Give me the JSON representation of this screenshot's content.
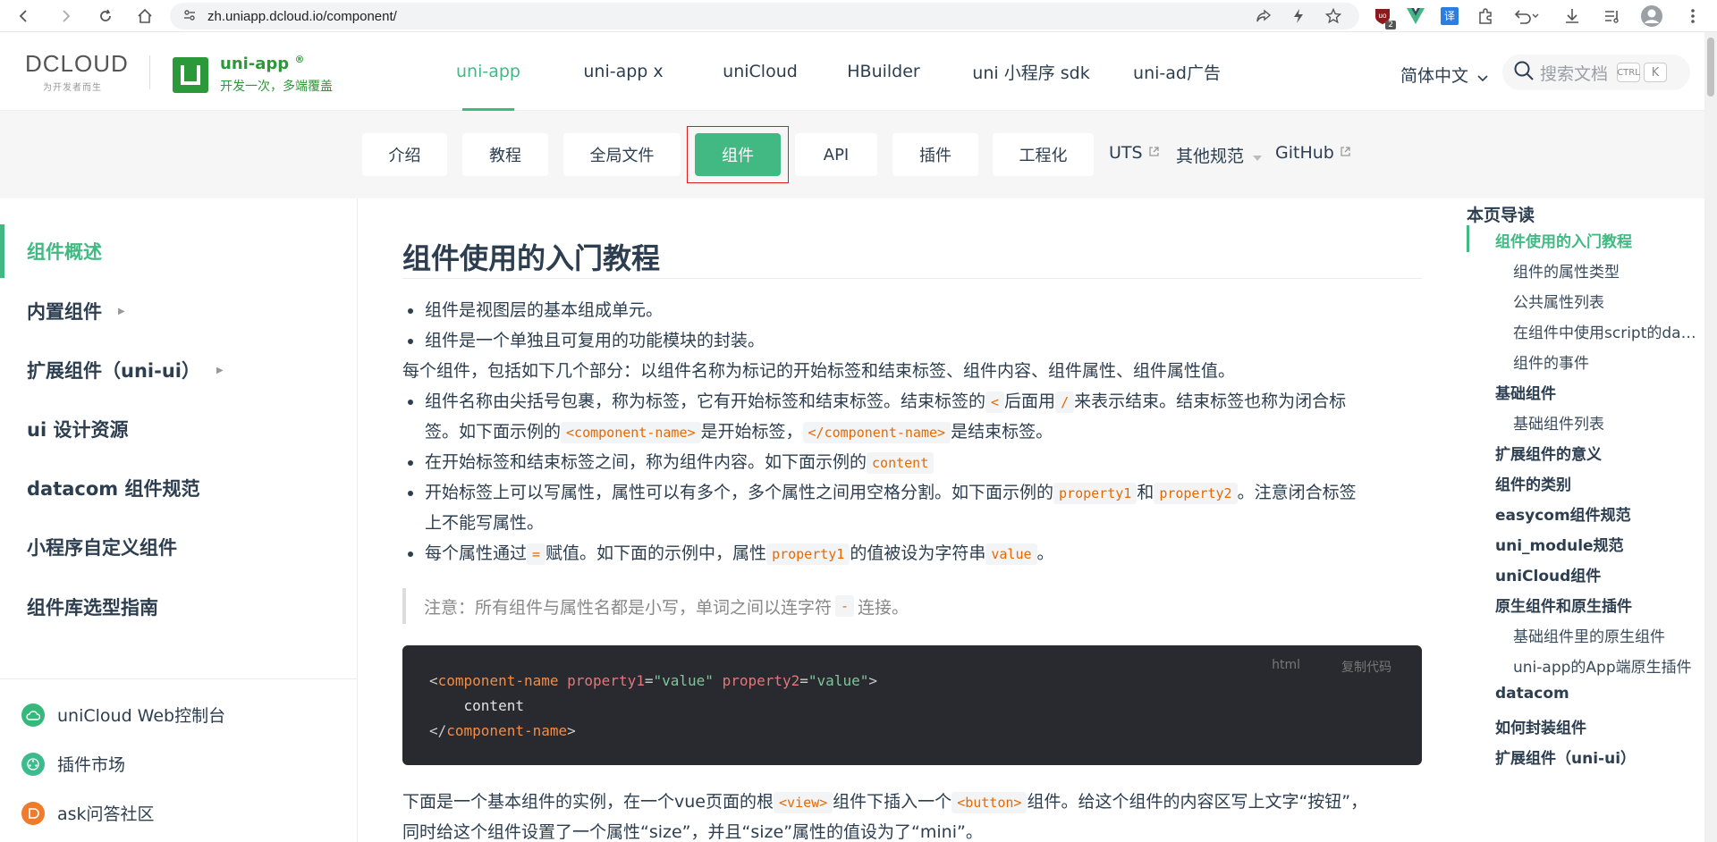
{
  "browser": {
    "url": "zh.uniapp.dcloud.io/component/",
    "back_icon": "back-arrow-icon",
    "forward_icon": "forward-arrow-icon",
    "reload_icon": "reload-icon",
    "home_icon": "home-icon",
    "badge_count": "2"
  },
  "header": {
    "dcloud_logo": "DCLOUD",
    "dcloud_tagline": "为开发者而生",
    "brand_title": "uni-app",
    "brand_reg": "®",
    "brand_sub": "开发一次，多端覆盖",
    "nav": [
      "uni-app",
      "uni-app x",
      "uniCloud",
      "HBuilder",
      "uni 小程序 sdk",
      "uni-ad广告"
    ],
    "active_nav": "uni-app",
    "lang": "简体中文",
    "search_placeholder": "搜索文档",
    "kbd_ctrl": "CTRL",
    "kbd_k": "K"
  },
  "subnav": {
    "tabs": [
      "介绍",
      "教程",
      "全局文件",
      "组件",
      "API",
      "插件",
      "工程化"
    ],
    "active_tab": "组件",
    "links": [
      "UTS",
      "其他规范",
      "GitHub"
    ]
  },
  "sidebar": {
    "items": [
      "组件概述",
      "内置组件",
      "扩展组件（uni-ui）",
      "ui 设计资源",
      "datacom 组件规范",
      "小程序自定义组件",
      "组件库选型指南"
    ],
    "links": [
      "uniCloud Web控制台",
      "插件市场",
      "ask问答社区"
    ]
  },
  "content": {
    "title": "组件使用的入门教程",
    "bullet1": "组件是视图层的基本组成单元。",
    "bullet2": "组件是一个单独且可复用的功能模块的封装。",
    "para1": "每个组件，包括如下几个部分：以组件名称为标记的开始标签和结束标签、组件内容、组件属性、组件属性值。",
    "b3a": "组件名称由尖括号包裹，称为标签，它有开始标签和结束标签。结束标签的",
    "b3_code1": "<",
    "b3b": "后面用",
    "b3_code2": "/",
    "b3c": "来表示结束。结束标签也称为闭合标",
    "b3d": "签。如下面示例的",
    "b3_code3": "<component-name>",
    "b3e": "是开始标签，",
    "b3_code4": "</component-name>",
    "b3f": "是结束标签。",
    "b4a": "在开始标签和结束标签之间，称为组件内容。如下面示例的",
    "b4_code": "content",
    "b5a": "开始标签上可以写属性，属性可以有多个，多个属性之间用空格分割。如下面示例的",
    "b5_code1": "property1",
    "b5b": "和",
    "b5_code2": "property2",
    "b5c": "。注意闭合标签",
    "b5d": "上不能写属性。",
    "b6a": "每个属性通过",
    "b6_code1": "=",
    "b6b": "赋值。如下面的示例中，属性",
    "b6_code2": "property1",
    "b6c": "的值被设为字符串",
    "b6_code3": "value",
    "b6d": "。",
    "tip_a": "注意：所有组件与属性名都是小写，单词之间以连字符",
    "tip_code": "-",
    "tip_b": "连接。",
    "code_lang": "html",
    "code_copy": "复制代码",
    "code_line1": {
      "open": "<",
      "tag": "component-name",
      "attr1": "property1",
      "eq1": "=",
      "val1": "\"value\"",
      "attr2": "property2",
      "eq2": "=",
      "val2": "\"value\"",
      "close": ">"
    },
    "code_line2": "content",
    "code_line3": {
      "open": "</",
      "tag": "component-name",
      "close": ">"
    },
    "para2a": "下面是一个基本组件的实例，在一个vue页面的根",
    "para2_code1": "<view>",
    "para2b": "组件下插入一个",
    "para2_code2": "<button>",
    "para2c": "组件。给这个组件的内容区写上文字“按钮”，",
    "para3": "同时给这个组件设置了一个属性“size”，并且“size”属性的值设为了“mini”。"
  },
  "toc": {
    "title": "本页导读",
    "items": [
      {
        "label": "组件使用的入门教程",
        "level": 1
      },
      {
        "label": "组件的属性类型",
        "level": 2
      },
      {
        "label": "公共属性列表",
        "level": 2
      },
      {
        "label": "在组件中使用script的data...",
        "level": 2
      },
      {
        "label": "组件的事件",
        "level": 2
      },
      {
        "label": "基础组件",
        "level": 1
      },
      {
        "label": "基础组件列表",
        "level": 2
      },
      {
        "label": "扩展组件的意义",
        "level": 1
      },
      {
        "label": "组件的类别",
        "level": 1
      },
      {
        "label": "easycom组件规范",
        "level": 1
      },
      {
        "label": "uni_module规范",
        "level": 1
      },
      {
        "label": "uniCloud组件",
        "level": 1
      },
      {
        "label": "原生组件和原生插件",
        "level": 1
      },
      {
        "label": "基础组件里的原生组件",
        "level": 2
      },
      {
        "label": "uni-app的App端原生插件",
        "level": 2
      },
      {
        "label": "datacom",
        "level": 1
      },
      {
        "label": "如何封装组件",
        "level": 1
      },
      {
        "label": "扩展组件（uni-ui）",
        "level": 1
      }
    ]
  },
  "colors": {
    "accent": "#42b983",
    "brand_green": "#2b9939",
    "focus_red": "#e21c1c",
    "code_bg": "#292a2f"
  }
}
